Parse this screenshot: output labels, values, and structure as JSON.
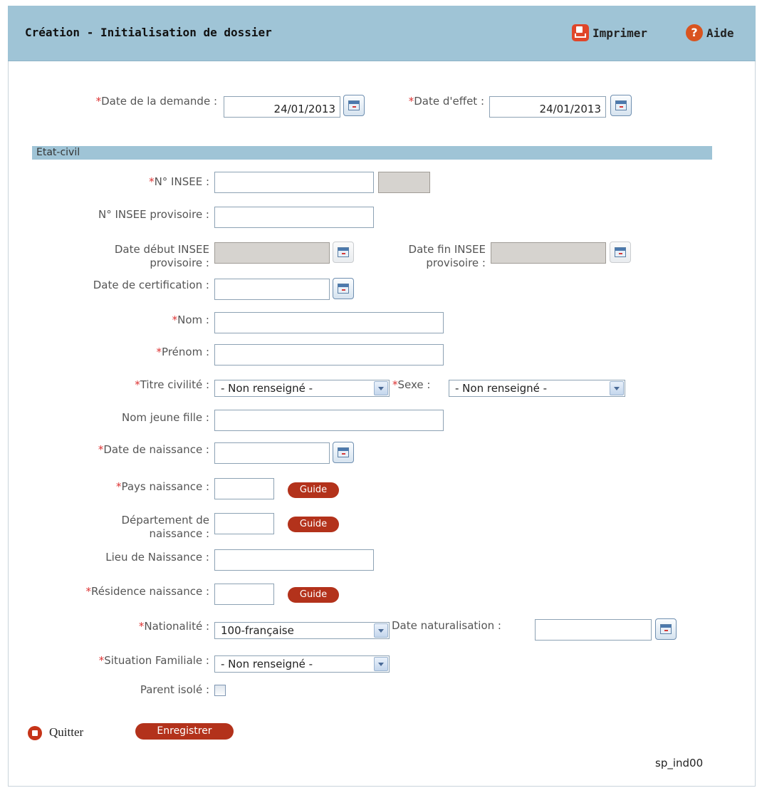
{
  "header": {
    "title": "Création - Initialisation de dossier",
    "print_label": "Imprimer",
    "help_label": "Aide"
  },
  "dates": {
    "demande_label": "Date de la demande :",
    "demande_value": "24/01/2013",
    "effet_label": "Date d'effet :",
    "effet_value": "24/01/2013"
  },
  "section": {
    "title": "Etat-civil"
  },
  "fields": {
    "insee": "N° INSEE :",
    "insee_prov": "N° INSEE provisoire :",
    "debut_insee_1": "Date début INSEE",
    "debut_insee_2": "provisoire :",
    "fin_insee_1": "Date fin INSEE",
    "fin_insee_2": "provisoire :",
    "certification": "Date de certification :",
    "nom": "Nom :",
    "prenom": "Prénom :",
    "titre": "Titre civilité :",
    "titre_value": "- Non renseigné -",
    "sexe": "Sexe :",
    "sexe_value": "- Non renseigné -",
    "nom_jf": "Nom jeune fille :",
    "date_naissance": "Date de naissance :",
    "pays": "Pays naissance :",
    "dept_1": "Département de",
    "dept_2": "naissance :",
    "lieu": "Lieu de Naissance :",
    "residence": "Résidence naissance :",
    "nationalite": "Nationalité :",
    "nationalite_value": "100-française",
    "naturalisation": "Date naturalisation :",
    "situation": "Situation Familiale :",
    "situation_value": "- Non renseigné -",
    "parent": "Parent isolé :"
  },
  "buttons": {
    "guide": "Guide",
    "quit": "Quitter",
    "save": "Enregistrer"
  },
  "footer": {
    "code": "sp_ind00"
  },
  "required_mark": "*",
  "colors": {
    "header_bg": "#9fc4d6",
    "button_bg": "#b3321b",
    "required": "#dd3333"
  }
}
